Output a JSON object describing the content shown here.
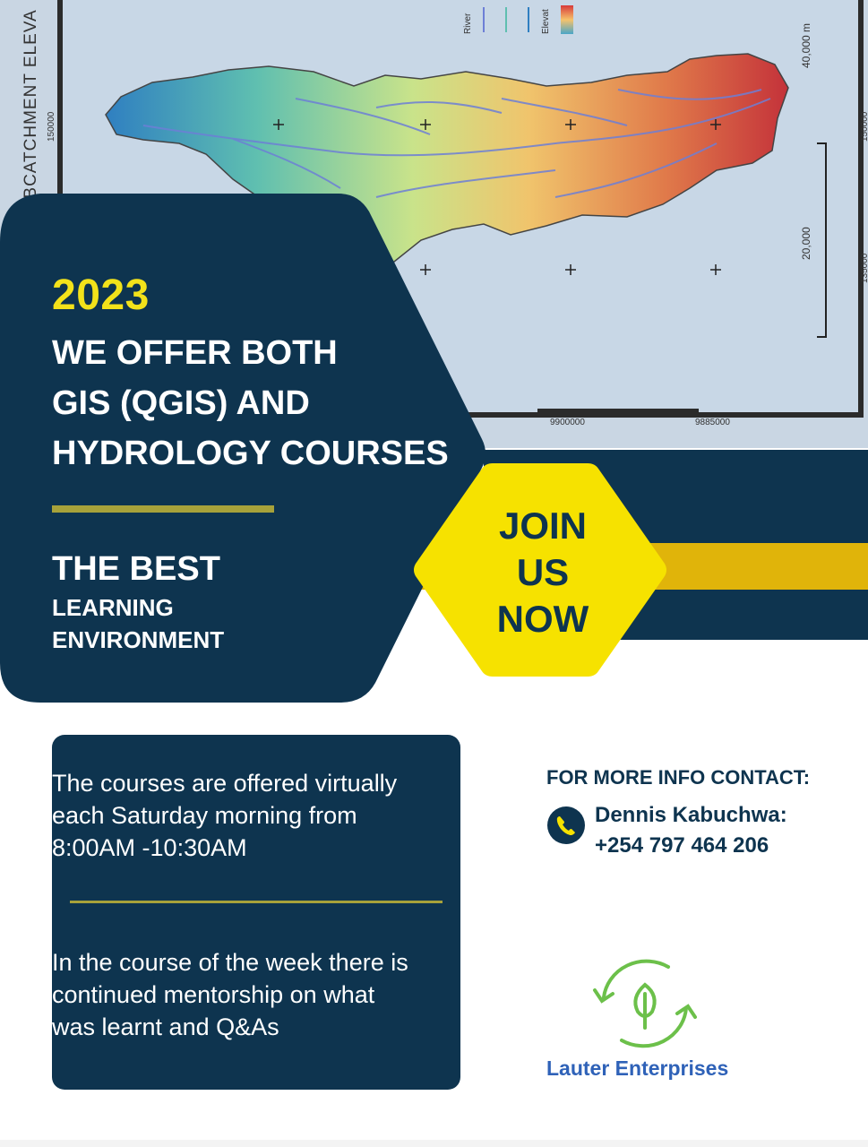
{
  "map": {
    "side_title": "SUBCATCHMENT ELEVA",
    "coord_left": "150000",
    "coord_right_top": "150000",
    "coord_right_bottom": "135000",
    "scale_40k": "40,000 m",
    "scale_20k": "20,000",
    "x_tick_1": "9900000",
    "x_tick_2": "9885000",
    "legend_river": "River",
    "legend_elev": "Elevat"
  },
  "hero": {
    "year": "2023",
    "headline_lines": [
      "WE OFFER BOTH",
      "GIS (QGIS) AND",
      "HYDROLOGY COURSES"
    ],
    "best": "THE BEST",
    "learning": "LEARNING",
    "environment": "ENVIRONMENT"
  },
  "cta": {
    "line1": "JOIN",
    "line2": "US",
    "line3": "NOW"
  },
  "info": {
    "para1_lines": [
      "The courses are offered virtually",
      "each Saturday morning from",
      "8:00AM -10:30AM"
    ],
    "para2_lines": [
      "In the course of the week there is",
      "continued mentorship on what",
      "was learnt and Q&As"
    ]
  },
  "contact": {
    "heading": "FOR MORE INFO CONTACT:",
    "name": "Dennis Kabuchwa:",
    "phone": "+254 797 464 206"
  },
  "brand": {
    "name": "Lauter Enterprises"
  },
  "colors": {
    "navy": "#0e344f",
    "yellow": "#f3e21a",
    "gold": "#e0b40a",
    "olive": "#a7a23a",
    "brand_blue": "#2f62b8",
    "logo_green": "#6cc04a"
  }
}
